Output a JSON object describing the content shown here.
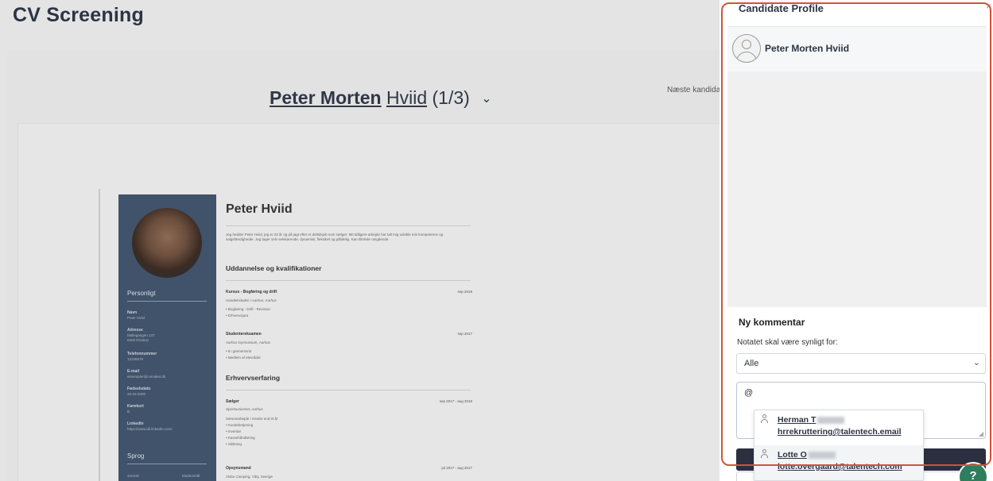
{
  "page": {
    "title": "CV Screening",
    "candidate_first": "Peter Morten",
    "candidate_last": "Hviid",
    "candidate_index": "(1/3)",
    "next_candidate": "Næste kandida"
  },
  "cv": {
    "name": "Peter Hviid",
    "intro": "Jeg hedder Peter Hviid, jeg er 22 år og på jagt efter et deltidsjob som sælger. Mit tidligere arbejde har talt mig udvikle min kompetence og salgsfærdigheder. Jeg tager selv selvkørende, dynamisk, fleksibel og pålidelig. Kan tiltræde omgående.",
    "personal_heading": "Personligt",
    "personal": [
      {
        "label": "Navn",
        "value": "Peter Hviid"
      },
      {
        "label": "Adresse",
        "value": "Mallegangen 137\n8200 Risskov"
      },
      {
        "label": "Telefonnummer",
        "value": "12345678"
      },
      {
        "label": "E-mail",
        "value": "eksempler@cvmaker.dk"
      },
      {
        "label": "Fødselsdato",
        "value": "26-03-2000"
      },
      {
        "label": "Kørekort",
        "value": "B"
      },
      {
        "label": "LinkedIn",
        "value": "https://www.dk.linkedin.com/"
      }
    ],
    "languages_heading": "Sprog",
    "language_row": {
      "lang": "Svensk",
      "level": "Modersmål"
    },
    "education_heading": "Uddannelse og kvalifikationer",
    "education": [
      {
        "title": "Kursus - Bogføring og drift",
        "place": "Handelsskolen i Aarhus, Aarhus",
        "date": "sep 2019",
        "bullets": [
          "Bogføring - Drift - Revision",
          "Erhvervsjura"
        ]
      },
      {
        "title": "Studentereksamen",
        "place": "Aarhus Gymnasium, Aarhus",
        "date": "sep 2017",
        "bullets": [
          "8 i gennemsnit",
          "Medlem af elevrådet"
        ]
      }
    ],
    "experience_heading": "Erhvervserfaring",
    "experience": [
      {
        "title": "Sælger",
        "place": "Sportsunivenet, Aarhus",
        "date": "sep 2017 - aug 2018",
        "desc": "Sæsonarbejde i mindre end ét år",
        "bullets": [
          "Kundebetjening",
          "Inventar",
          "Kassehåndtering",
          "Skiltning"
        ]
      },
      {
        "title": "Opsynsmand",
        "place": "Vivbu Camping, Viby, Sverige",
        "date": "jul 2017 - aug 2017"
      }
    ]
  },
  "drawer": {
    "title": "Candidate Profile",
    "close_icon": "×",
    "candidate_name": "Peter Morten Hviid",
    "new_comment_heading": "Ny kommentar",
    "visibility_label": "Notatet skal være synligt for:",
    "visibility_value": "Alle",
    "select_chevron": "⌄",
    "comment_value": "@",
    "resize_grip": "◢"
  },
  "mentions": [
    {
      "name": "Herman T",
      "email": "hrrekruttering@talentech.email"
    },
    {
      "name": "Lotte O",
      "email": "lotte.overgaard@talentech.com"
    }
  ],
  "help": {
    "label": "?"
  },
  "colors": {
    "highlight": "#d3523a",
    "button_dark": "#2b2f3f",
    "help_green": "#2f7d5c",
    "cv_sidebar": "#41536a"
  }
}
